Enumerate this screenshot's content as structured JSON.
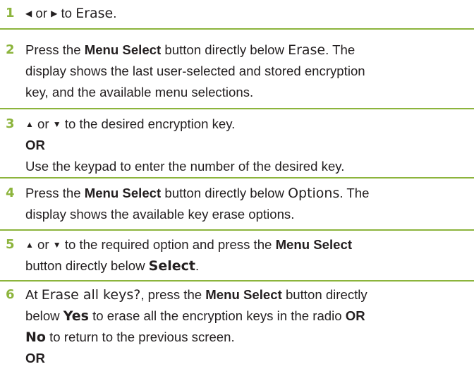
{
  "colors": {
    "accent": "#8cb43c",
    "text": "#231f20"
  },
  "icons": {
    "left_arrow": "left-arrow-icon",
    "right_arrow": "right-arrow-icon",
    "up_arrow": "up-arrow-icon",
    "down_arrow": "down-arrow-icon"
  },
  "steps": [
    {
      "number": "1",
      "l1": {
        "g1": "◀",
        "t1": " or ",
        "g2": "▶",
        "t2": " to ",
        "d1": "Erase",
        "t3": "."
      }
    },
    {
      "number": "2",
      "l1": {
        "t1": "Press the ",
        "b1": "Menu Select",
        "t2": " button directly below ",
        "d1": "Erase",
        "t3": ". The"
      },
      "l2": "display shows the last user-selected and stored encryption",
      "l3": "key, and the available menu selections."
    },
    {
      "number": "3",
      "l1": {
        "g1": "▲",
        "t1": " or ",
        "g2": "▼",
        "t2": " to the desired encryption key."
      },
      "or": "OR",
      "l3": "Use the keypad to enter the number of the desired key."
    },
    {
      "number": "4",
      "l1": {
        "t1": "Press the ",
        "b1": "Menu Select",
        "t2": " button directly below ",
        "d1": "Options",
        "t3": ". The"
      },
      "l2": "display shows the available key erase options."
    },
    {
      "number": "5",
      "l1": {
        "g1": "▲",
        "t1": " or ",
        "g2": "▼",
        "t2": " to the required option and press the ",
        "b1": "Menu Select"
      },
      "l2": {
        "t1": "button directly below ",
        "d1": "Select",
        "t2": "."
      }
    },
    {
      "number": "6",
      "l1": {
        "t1": "At ",
        "d1": "Erase all keys?",
        "t2": ", press the ",
        "b1": "Menu Select",
        "t3": " button directly"
      },
      "l2": {
        "t1": "below ",
        "d1": "Yes",
        "t2": " to erase all the encryption keys in the radio ",
        "b1": "OR"
      },
      "l3": {
        "d1": "No",
        "t1": " to return to the previous screen."
      },
      "or": "OR"
    }
  ]
}
